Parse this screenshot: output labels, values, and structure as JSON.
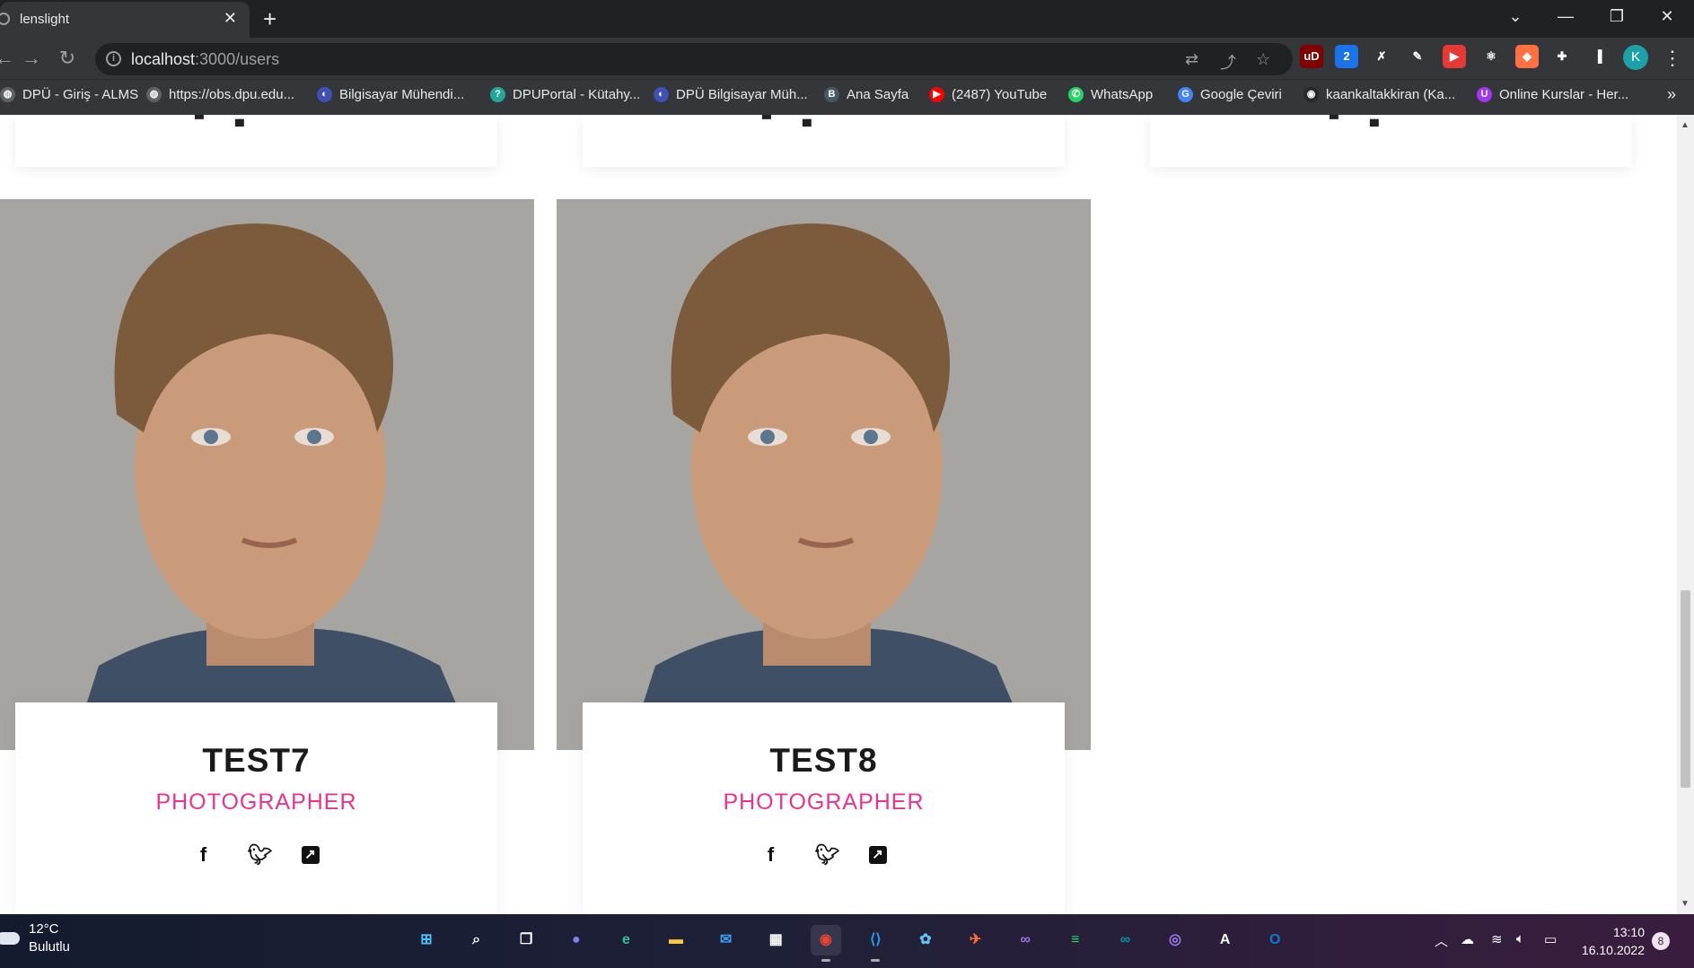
{
  "browser": {
    "tab_title": "lenslight",
    "url_host": "localhost",
    "url_path": ":3000/users",
    "profile_initial": "K",
    "bookmarks": [
      {
        "label": "DPÜ - Giriş - ALMS",
        "icon": "globe-icon"
      },
      {
        "label": "https://obs.dpu.edu...",
        "icon": "globe-icon"
      },
      {
        "label": "Bilgisayar Mühendi...",
        "icon": "site-icon"
      },
      {
        "label": "DPUPortal - Kütahy...",
        "icon": "question-icon"
      },
      {
        "label": "DPÜ Bilgisayar Müh...",
        "icon": "site-icon"
      },
      {
        "label": "Ana Sayfa",
        "icon": "btk-icon"
      },
      {
        "label": "(2487) YouTube",
        "icon": "youtube-icon"
      },
      {
        "label": "WhatsApp",
        "icon": "whatsapp-icon"
      },
      {
        "label": "Google Çeviri",
        "icon": "translate-icon"
      },
      {
        "label": "kaankaltakkiran (Ka...",
        "icon": "github-icon"
      },
      {
        "label": "Online Kurslar - Her...",
        "icon": "udemy-icon"
      }
    ],
    "extensions": [
      {
        "icon": "ublock-icon",
        "text": "uD",
        "color": "#800000"
      },
      {
        "icon": "dict-icon",
        "text": "2",
        "color": "#1a73e8"
      },
      {
        "icon": "tools-icon",
        "text": "✗",
        "color": "#35363a"
      },
      {
        "icon": "pencil-icon",
        "text": "✎",
        "color": "#35363a"
      },
      {
        "icon": "youtube-ext-icon",
        "text": "▶",
        "color": "#e53935"
      },
      {
        "icon": "react-icon",
        "text": "⚛",
        "color": "#35363a"
      },
      {
        "icon": "orange-ext-icon",
        "text": "◆",
        "color": "#ff7043"
      },
      {
        "icon": "puzzle-icon",
        "text": "✚",
        "color": "#35363a"
      },
      {
        "icon": "sidepanel-icon",
        "text": "▐",
        "color": "#35363a"
      }
    ]
  },
  "page": {
    "users": [
      {
        "name": "TEST7",
        "role": "PHOTOGRAPHER"
      },
      {
        "name": "TEST8",
        "role": "PHOTOGRAPHER"
      }
    ],
    "social_icons": [
      "facebook-icon",
      "twitter-icon",
      "external-link-icon"
    ],
    "role_color": "#e8338f"
  },
  "taskbar": {
    "weather_temp": "12°C",
    "weather_condition": "Bulutlu",
    "time": "13:10",
    "date": "16.10.2022",
    "notification_count": "8",
    "apps": [
      {
        "icon": "windows-start-icon"
      },
      {
        "icon": "search-icon"
      },
      {
        "icon": "task-view-icon"
      },
      {
        "icon": "teams-chat-icon"
      },
      {
        "icon": "edge-icon"
      },
      {
        "icon": "file-explorer-icon"
      },
      {
        "icon": "mail-icon"
      },
      {
        "icon": "store-icon"
      },
      {
        "icon": "chrome-icon"
      },
      {
        "icon": "vscode-icon"
      },
      {
        "icon": "paint-icon"
      },
      {
        "icon": "postman-icon"
      },
      {
        "icon": "visual-studio-icon"
      },
      {
        "icon": "spotify-icon"
      },
      {
        "icon": "arduino-icon"
      },
      {
        "icon": "github-desktop-icon"
      },
      {
        "icon": "app-icon"
      },
      {
        "icon": "outlook-icon"
      }
    ]
  }
}
